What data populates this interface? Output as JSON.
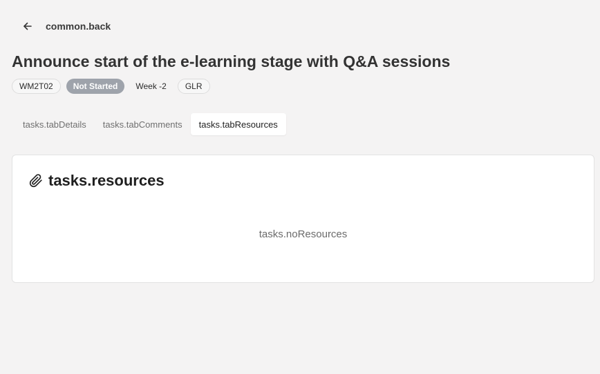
{
  "nav": {
    "back_label": "common.back",
    "back_icon": "arrow-left-icon"
  },
  "task": {
    "title": "Announce start of the e-learning stage with Q&A sessions",
    "code": "WM2T02",
    "status": "Not Started",
    "week": "Week -2",
    "group": "GLR"
  },
  "tabs": [
    {
      "label": "tasks.tabDetails",
      "active": false
    },
    {
      "label": "tasks.tabComments",
      "active": false
    },
    {
      "label": "tasks.tabResources",
      "active": true
    }
  ],
  "resources": {
    "icon": "paperclip-icon",
    "title": "tasks.resources",
    "empty_text": "tasks.noResources"
  },
  "colors": {
    "background": "#f4f3f3",
    "status_badge": "#9ea3ab",
    "card": "#ffffff"
  }
}
